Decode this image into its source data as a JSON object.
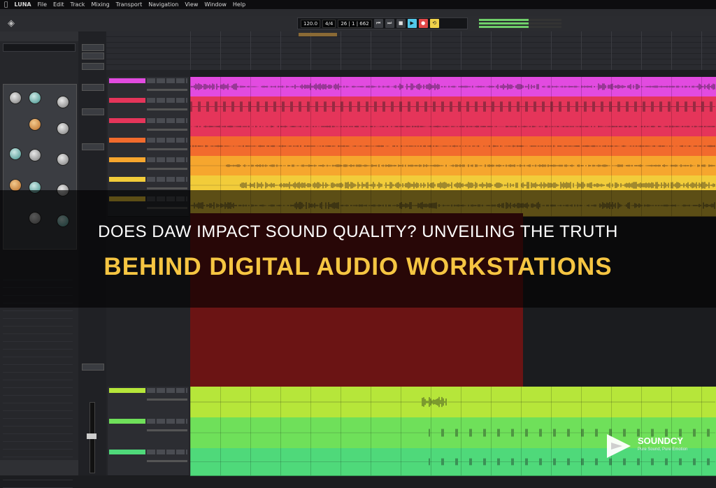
{
  "menubar": {
    "apple": "",
    "items": [
      "LUNA",
      "File",
      "Edit",
      "Track",
      "Mixing",
      "Transport",
      "Navigation",
      "View",
      "Window",
      "Help"
    ]
  },
  "transport": {
    "tempo": "120.0",
    "signature": "4/4",
    "position": "26 | 1 | 662"
  },
  "overlay": {
    "headline_line1": "DOES DAW IMPACT SOUND QUALITY? UNVEILING THE TRUTH",
    "headline_line2": "BEHIND DIGITAL AUDIO WORKSTATIONS"
  },
  "brand": {
    "name": "SOUNDCY",
    "tagline": "Pure Sound, Pure Emotion"
  },
  "colors": {
    "lane_magenta": "#e24be0",
    "lane_red": "#e5355a",
    "lane_orange": "#f26b2d",
    "lane_amber": "#f6a62e",
    "lane_yellow": "#f2cc3a",
    "lane_lime": "#b6e63a",
    "lane_green": "#6fe05a",
    "lane_green2": "#4fd97a",
    "headline_accent": "#f5c542"
  }
}
